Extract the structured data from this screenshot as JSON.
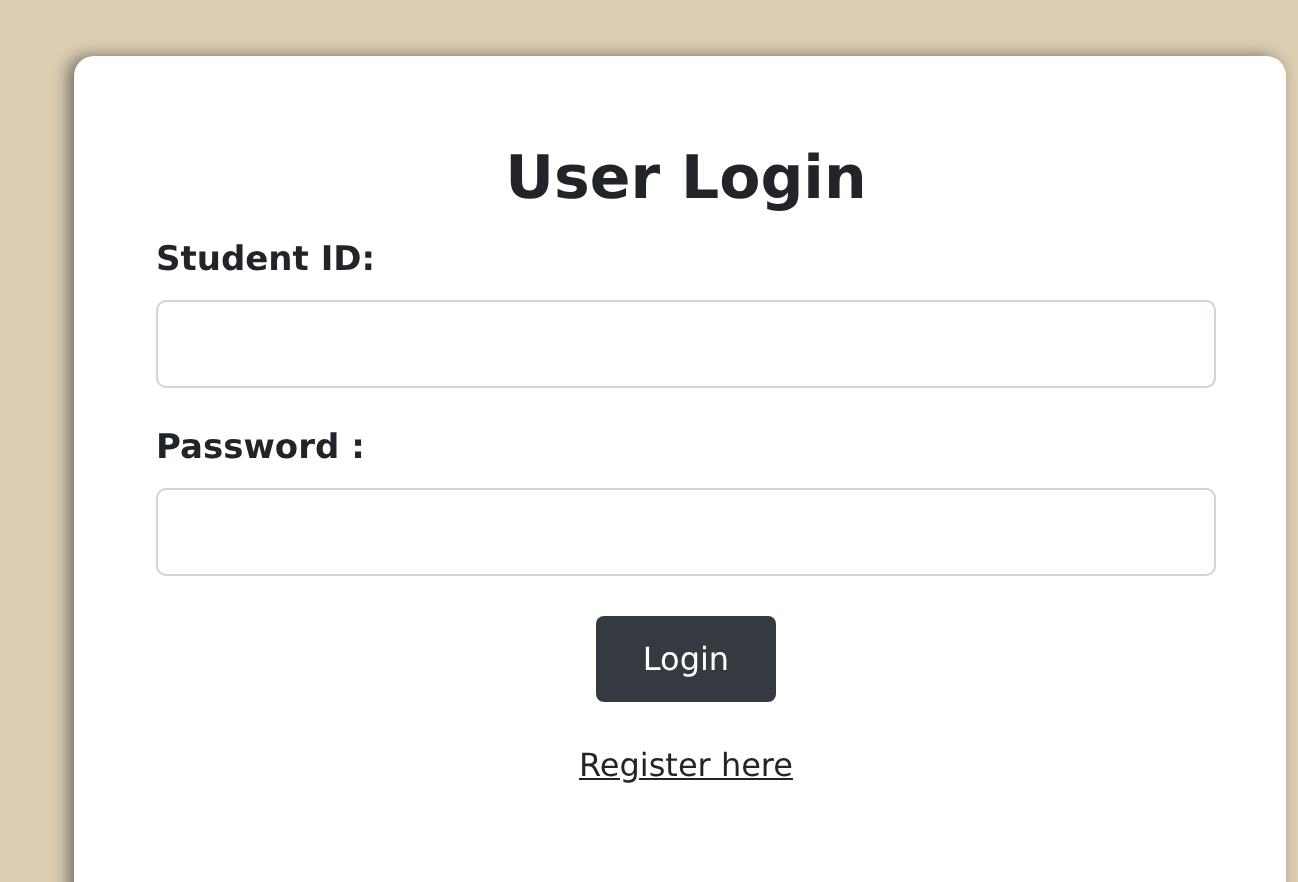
{
  "title": "User Login",
  "fields": [
    {
      "label": "Student ID:"
    },
    {
      "label": "Password :"
    }
  ],
  "button": "Login",
  "link": "Register here"
}
